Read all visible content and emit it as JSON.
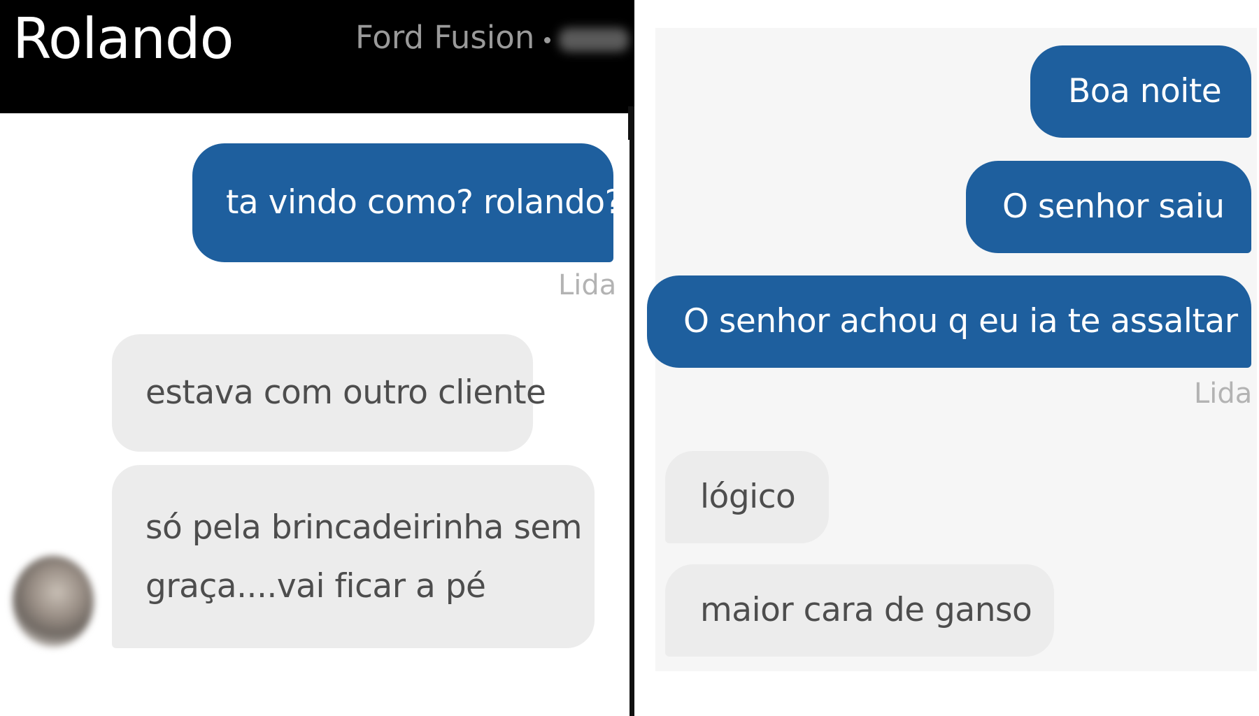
{
  "left_chat": {
    "contact_name": "Rolando",
    "vehicle": "Ford Fusion",
    "messages": [
      {
        "direction": "out",
        "text": "ta vindo como? rolando?"
      },
      {
        "direction": "in",
        "text": "estava com outro cliente"
      },
      {
        "direction": "in",
        "line1": "só pela brincadeirinha sem",
        "line2": "graça....vai ficar a pé"
      }
    ],
    "read_status": "Lida"
  },
  "right_chat": {
    "messages": [
      {
        "direction": "out",
        "text": "Boa noite"
      },
      {
        "direction": "out",
        "text": "O senhor saiu"
      },
      {
        "direction": "out",
        "text": "O senhor achou q eu ia te assaltar"
      },
      {
        "direction": "in",
        "text": "lógico"
      },
      {
        "direction": "in",
        "text": "maior cara de ganso"
      }
    ],
    "read_status": "Lida"
  },
  "colors": {
    "outgoing_bubble": "#1e5f9e",
    "incoming_bubble": "#ececec",
    "header_bg": "#000000",
    "read_label": "#b3b3b3"
  },
  "icons": {
    "avatar": "blurred-profile-photo"
  }
}
